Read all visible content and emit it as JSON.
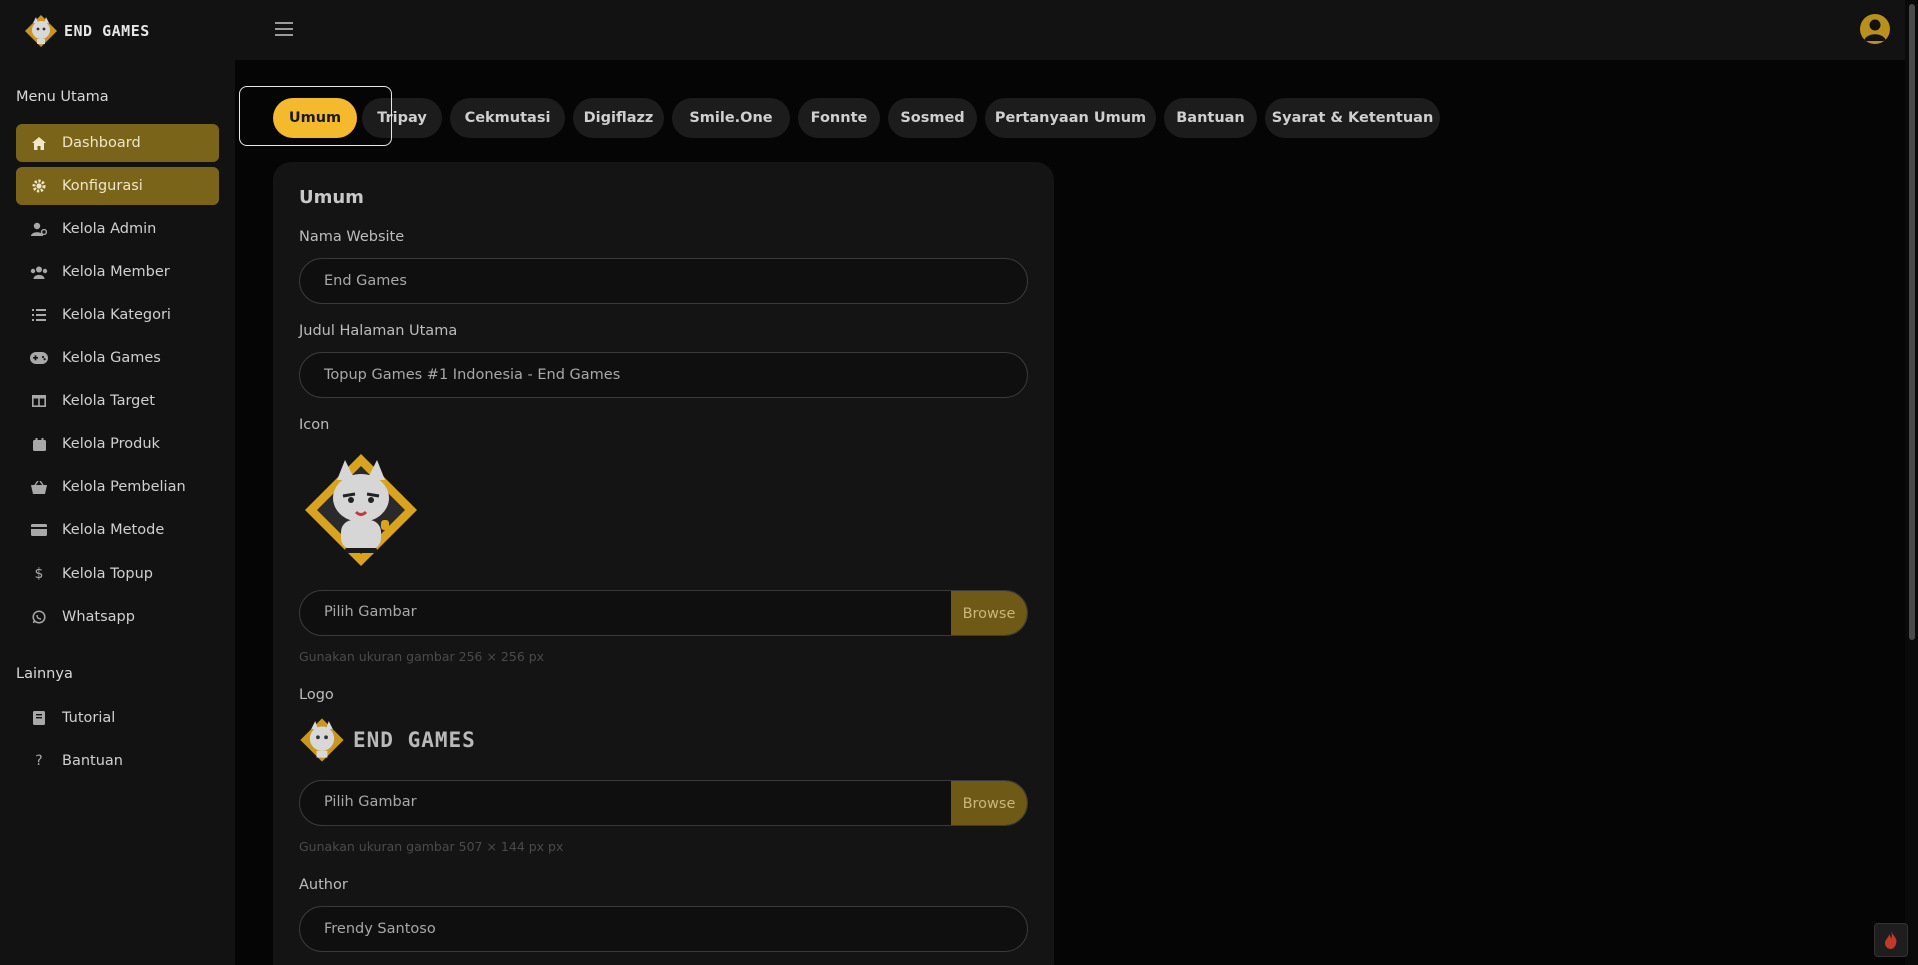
{
  "brand": {
    "name": "END GAMES"
  },
  "sidebar": {
    "section_main": "Menu Utama",
    "items": [
      {
        "label": "Dashboard",
        "icon": "home-icon"
      },
      {
        "label": "Konfigurasi",
        "icon": "gear-icon"
      },
      {
        "label": "Kelola Admin",
        "icon": "user-gear-icon"
      },
      {
        "label": "Kelola Member",
        "icon": "users-icon"
      },
      {
        "label": "Kelola Kategori",
        "icon": "list-icon"
      },
      {
        "label": "Kelola Games",
        "icon": "gamepad-icon"
      },
      {
        "label": "Kelola Target",
        "icon": "table-icon"
      },
      {
        "label": "Kelola Produk",
        "icon": "box-icon"
      },
      {
        "label": "Kelola Pembelian",
        "icon": "basket-icon"
      },
      {
        "label": "Kelola Metode",
        "icon": "credit-card-icon"
      },
      {
        "label": "Kelola Topup",
        "icon": "dollar-icon"
      },
      {
        "label": "Whatsapp",
        "icon": "whatsapp-icon"
      }
    ],
    "section_other": "Lainnya",
    "other_items": [
      {
        "label": "Tutorial",
        "icon": "book-icon"
      },
      {
        "label": "Bantuan",
        "icon": "question-icon"
      }
    ]
  },
  "tabs": [
    "Umum",
    "Tripay",
    "Cekmutasi",
    "Digiflazz",
    "Smile.One",
    "Fonnte",
    "Sosmed",
    "Pertanyaan Umum",
    "Bantuan",
    "Syarat & Ketentuan"
  ],
  "form": {
    "title": "Umum",
    "nama_website": {
      "label": "Nama Website",
      "value": "End Games"
    },
    "judul": {
      "label": "Judul Halaman Utama",
      "value": "Topup Games #1 Indonesia - End Games"
    },
    "icon": {
      "label": "Icon",
      "placeholder": "Pilih Gambar",
      "browse": "Browse",
      "help": "Gunakan ukuran gambar 256 × 256 px"
    },
    "logo": {
      "label": "Logo",
      "logo_text": "END GAMES",
      "placeholder": "Pilih Gambar",
      "browse": "Browse",
      "help": "Gunakan ukuran gambar 507 × 144 px px"
    },
    "author": {
      "label": "Author",
      "value": "Frendy Santoso"
    }
  },
  "colors": {
    "accent": "#f5b92e",
    "active_nav": "#7a6419",
    "browse": "#6e5a16"
  }
}
